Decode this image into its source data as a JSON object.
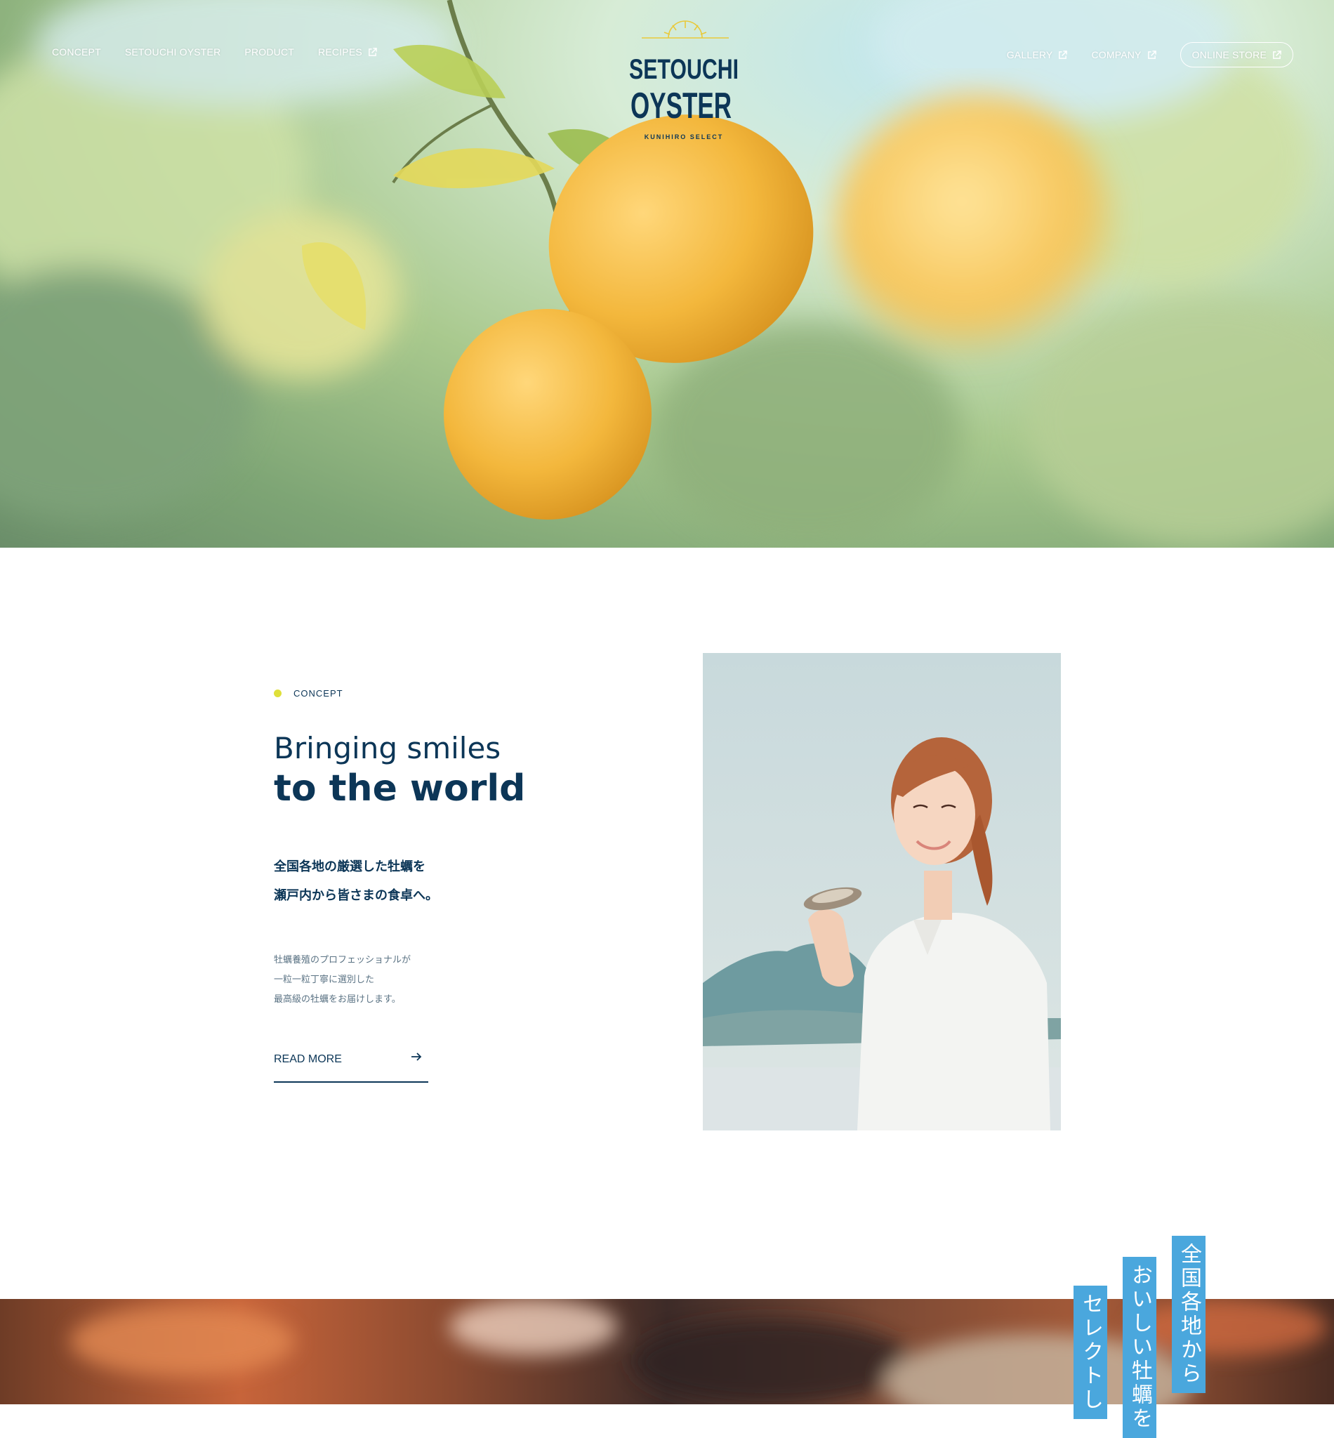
{
  "nav": {
    "left": [
      {
        "label": "CONCEPT"
      },
      {
        "label": "SETOUCHI OYSTER"
      },
      {
        "label": "PRODUCT"
      },
      {
        "label": "RECIPES",
        "icon": "external-link-icon"
      }
    ],
    "right": [
      {
        "label": "GALLERY",
        "icon": "external-link-icon"
      },
      {
        "label": "COMPANY",
        "icon": "external-link-icon"
      }
    ],
    "store_button": {
      "label": "ONLINE STORE",
      "icon": "external-link-icon"
    }
  },
  "logo": {
    "line1": "SETOUCHI",
    "line2": "OYSTER",
    "tagline": "KUNIHIRO SELECT",
    "color": "#0c3657",
    "accent": "#e9c93a"
  },
  "concept": {
    "eyebrow": "CONCEPT",
    "title_light": "Bringing smiles",
    "title_bold": "to the world",
    "lead": [
      "全国各地の厳選した牡蠣を",
      "瀬戸内から皆さまの食卓へ。"
    ],
    "body": [
      "牡蠣養殖のプロフェッショナルが",
      "一粒一粒丁寧に選別した",
      "最高級の牡蠣をお届けします。"
    ],
    "read_more": "READ MORE"
  },
  "vertical_captions": [
    "全国各地から",
    "おいしい牡蠣を",
    "セレクトし"
  ],
  "colors": {
    "primary": "#0c3657",
    "accent_dot": "#dfe03a",
    "caption_bg": "#4aa7dd"
  }
}
